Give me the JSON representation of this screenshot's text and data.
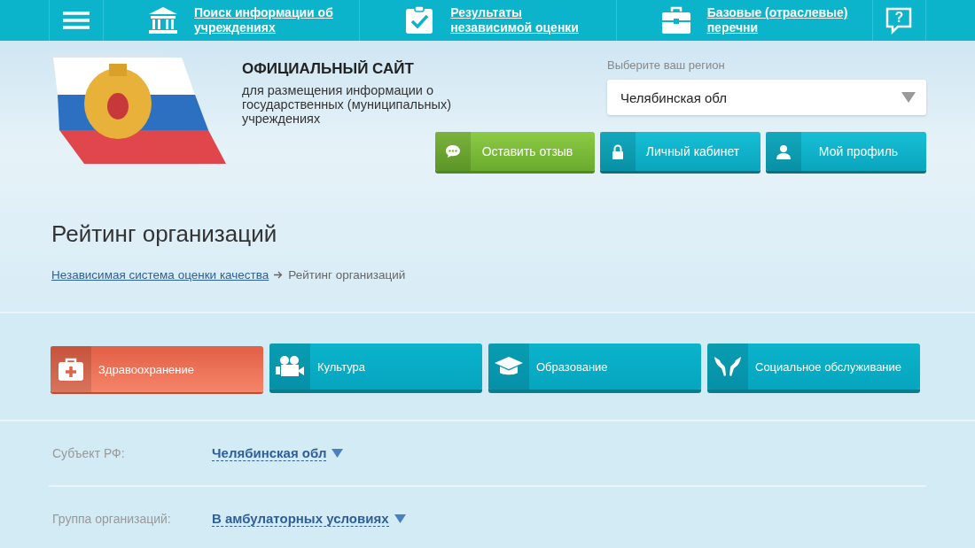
{
  "nav": {
    "items": [
      {
        "kind": "institution",
        "label": "Поиск информации об учреждениях"
      },
      {
        "kind": "check",
        "label": "Результаты независимой оценки"
      },
      {
        "kind": "briefcase",
        "label": "Базовые (отраслевые) перечни"
      }
    ],
    "help": "?"
  },
  "header": {
    "title": "ОФИЦИАЛЬНЫЙ САЙТ",
    "subtitle": "для размещения информации о государственных (муниципальных) учреждениях",
    "region_label": "Выберите ваш регион",
    "region_value": "Челябинская обл",
    "buttons": [
      {
        "kind": "feedback",
        "label": "Оставить отзыв"
      },
      {
        "kind": "lock",
        "label": "Личный кабинет"
      },
      {
        "kind": "user",
        "label": "Мой профиль"
      }
    ]
  },
  "page_title": "Рейтинг организаций",
  "breadcrumb": [
    {
      "label": "Независимая система оценки качества",
      "link": true
    },
    {
      "label": "Рейтинг организаций",
      "link": false
    }
  ],
  "categories": [
    {
      "kind": "health",
      "label": "Здравоохранение",
      "selected": true
    },
    {
      "kind": "culture",
      "label": "Культура",
      "selected": false
    },
    {
      "kind": "education",
      "label": "Образование",
      "selected": false
    },
    {
      "kind": "social",
      "label": "Социальное обслуживание",
      "selected": false
    }
  ],
  "filters": [
    {
      "label": "Субъект РФ:",
      "value": "Челябинская обл"
    },
    {
      "label": "Группа организаций:",
      "value": "В амбулаторных условиях"
    }
  ]
}
